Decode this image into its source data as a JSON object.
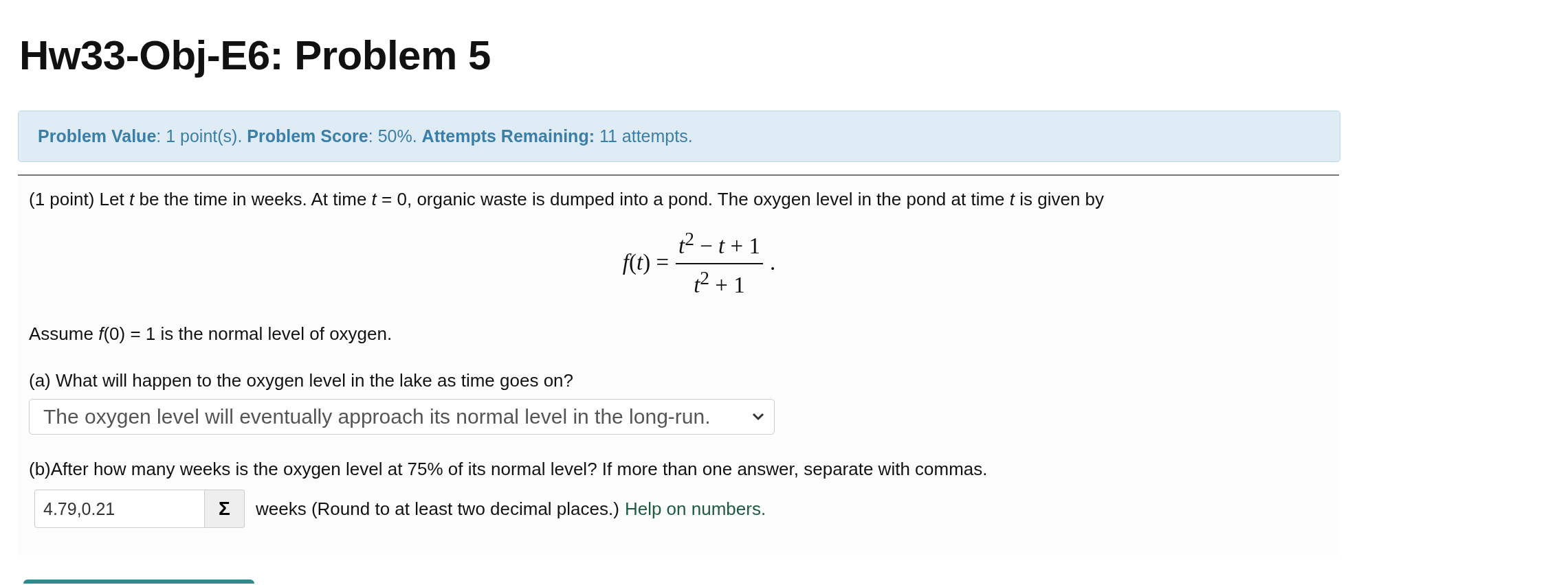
{
  "title": "Hw33-Obj-E6: Problem 5",
  "info": "**Problem Value**: 1 point(s). **Problem Score**: 50%. **Attempts Remaining:** 11 attempts.",
  "intro": "(1 point) Let *t* be the time in weeks. At time *t* = 0, organic waste is dumped into a pond. The oxygen level in the pond at time *t* is given by",
  "formula": {
    "lhs": "*f*(*t*) =",
    "numerator": "*t*$^{2}$ − *t* + 1",
    "denominator": "*t*$^{2}$ + 1",
    "trailing": "."
  },
  "assume": "Assume *f*(0) = 1 is the normal level of oxygen.",
  "part_a": {
    "question": "(a) What will happen to the oxygen level in the lake as time goes on?",
    "answer": "The oxygen level will eventually approach its normal level in the long-run."
  },
  "part_b": {
    "question": "(b)After how many weeks is the oxygen level at 75% of its normal level? If more than one answer, separate with commas.",
    "value": "4.79,0.21",
    "sigma": "Σ",
    "unit": "weeks (Round to at least two decimal places.)",
    "help_link": "Help on numbers."
  }
}
